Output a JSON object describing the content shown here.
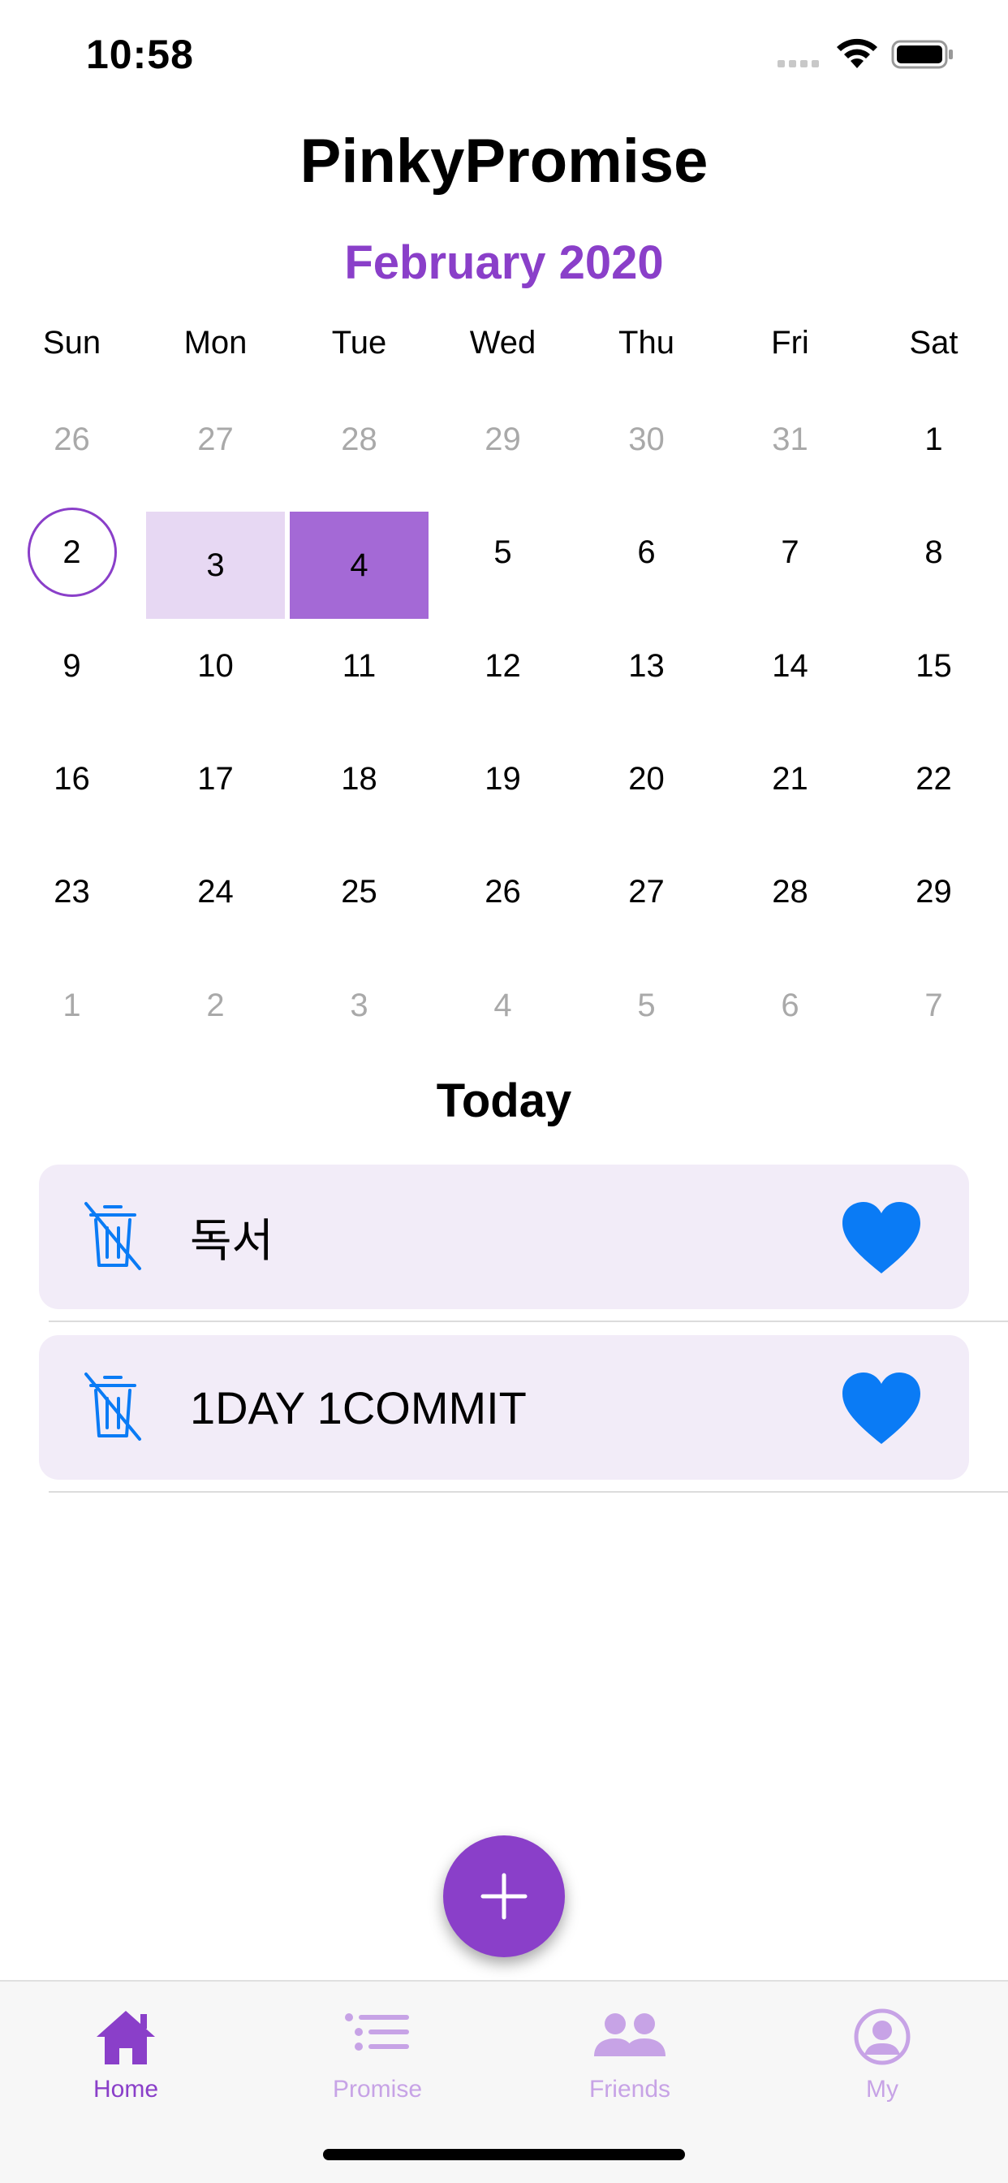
{
  "status_bar": {
    "time": "10:58"
  },
  "app_title": "PinkyPromise",
  "calendar": {
    "month_title": "February 2020",
    "weekdays": [
      "Sun",
      "Mon",
      "Tue",
      "Wed",
      "Thu",
      "Fri",
      "Sat"
    ],
    "weeks": [
      [
        "26",
        "27",
        "28",
        "29",
        "30",
        "31",
        "1"
      ],
      [
        "2",
        "3",
        "4",
        "5",
        "6",
        "7",
        "8"
      ],
      [
        "9",
        "10",
        "11",
        "12",
        "13",
        "14",
        "15"
      ],
      [
        "16",
        "17",
        "18",
        "19",
        "20",
        "21",
        "22"
      ],
      [
        "23",
        "24",
        "25",
        "26",
        "27",
        "28",
        "29"
      ],
      [
        "1",
        "2",
        "3",
        "4",
        "5",
        "6",
        "7"
      ]
    ]
  },
  "today_section": {
    "title": "Today",
    "items": [
      {
        "label": "독서",
        "delete_icon": "trash-slash-icon",
        "favorite_icon": "heart-filled-icon"
      },
      {
        "label": "1DAY 1COMMIT",
        "delete_icon": "trash-slash-icon",
        "favorite_icon": "heart-filled-icon"
      }
    ]
  },
  "fab": {
    "icon": "plus-icon"
  },
  "tab_bar": {
    "tabs": [
      {
        "label": "Home",
        "icon": "house-icon",
        "active": true
      },
      {
        "label": "Promise",
        "icon": "list-icon",
        "active": false
      },
      {
        "label": "Friends",
        "icon": "people-icon",
        "active": false
      },
      {
        "label": "My",
        "icon": "person-circle-icon",
        "active": false
      }
    ]
  },
  "colors": {
    "accent": "#8a3fc9",
    "selected_light": "#e7d8f3",
    "selected_strong": "#a469d6",
    "card_bg": "#f2ecf8",
    "icon_blue": "#0a7bf5",
    "tab_inactive": "#c7a3e6"
  }
}
